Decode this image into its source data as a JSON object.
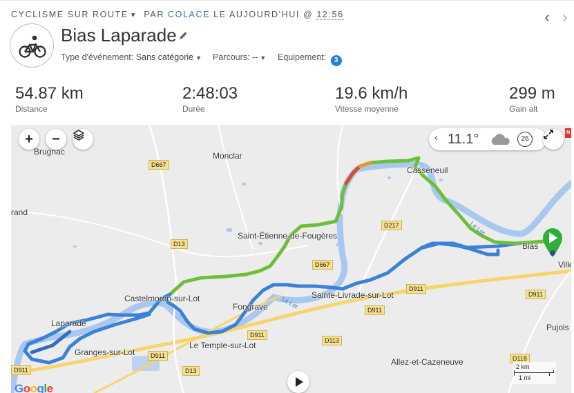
{
  "header": {
    "sport": "CYCLISME SUR ROUTE",
    "by": "PAR",
    "author": "COLACE",
    "date": "LE AUJOURD'HUI @",
    "time": "12:56"
  },
  "activity": {
    "title": "Bias Laparade",
    "icon": "bike-icon",
    "event_type_label": "Type d'événement:",
    "event_type_value": "Sans catégorie",
    "course_label": "Parcours:",
    "course_value": "--",
    "equipment_label": "Equipement:",
    "equipment_count": "3"
  },
  "stats": [
    {
      "value": "54.87 km",
      "label": "Distance"
    },
    {
      "value": "2:48:03",
      "label": "Durée"
    },
    {
      "value": "19.6 km/h",
      "label": "Vitesse moyenne"
    },
    {
      "value": "299 m",
      "label": "Gain alt"
    }
  ],
  "map": {
    "weather_temp": "11.1°",
    "wind": "26",
    "scale_km": "2 km",
    "scale_mi": "1 mi",
    "provider": "Google",
    "places": {
      "brugnac": "Brugnac",
      "monclar": "Monclar",
      "casseneuil": "Casseneuil",
      "saint_etienne": "Saint-Étienne-de-Fougères",
      "castelmoron": "Castelmoron-sur-Lot",
      "fongrave": "Fongrave",
      "sainte_livrade": "Sainte-Livrade-sur-Lot",
      "laparade": "Laparade",
      "le_temple": "Le Temple-sur-Lot",
      "granges": "Granges-sur-Lot",
      "allez": "Allez-et-Cazeneuve",
      "pujols": "Pujols",
      "rand": "rand",
      "bias": "Bias",
      "ville": "Ville"
    },
    "roads": {
      "d667a": "D667",
      "d13a": "D13",
      "d217": "D217",
      "d667b": "D667",
      "d911a": "D911",
      "d911b": "D911",
      "d911c": "D911",
      "d911d": "D911",
      "d911e": "D911",
      "d911f": "D911",
      "d113": "D113",
      "d13b": "D13",
      "d118": "D118"
    },
    "rivers": {
      "lot1": "Le Lot",
      "lot2": "Le Lot"
    }
  },
  "colors": {
    "accent": "#2a6fb0",
    "badge": "#2a7fd4",
    "track_fast": "#3b82d6",
    "track_mid": "#6cbf3a",
    "track_slow": "#d94a2a",
    "start_marker": "#2eae3b"
  }
}
